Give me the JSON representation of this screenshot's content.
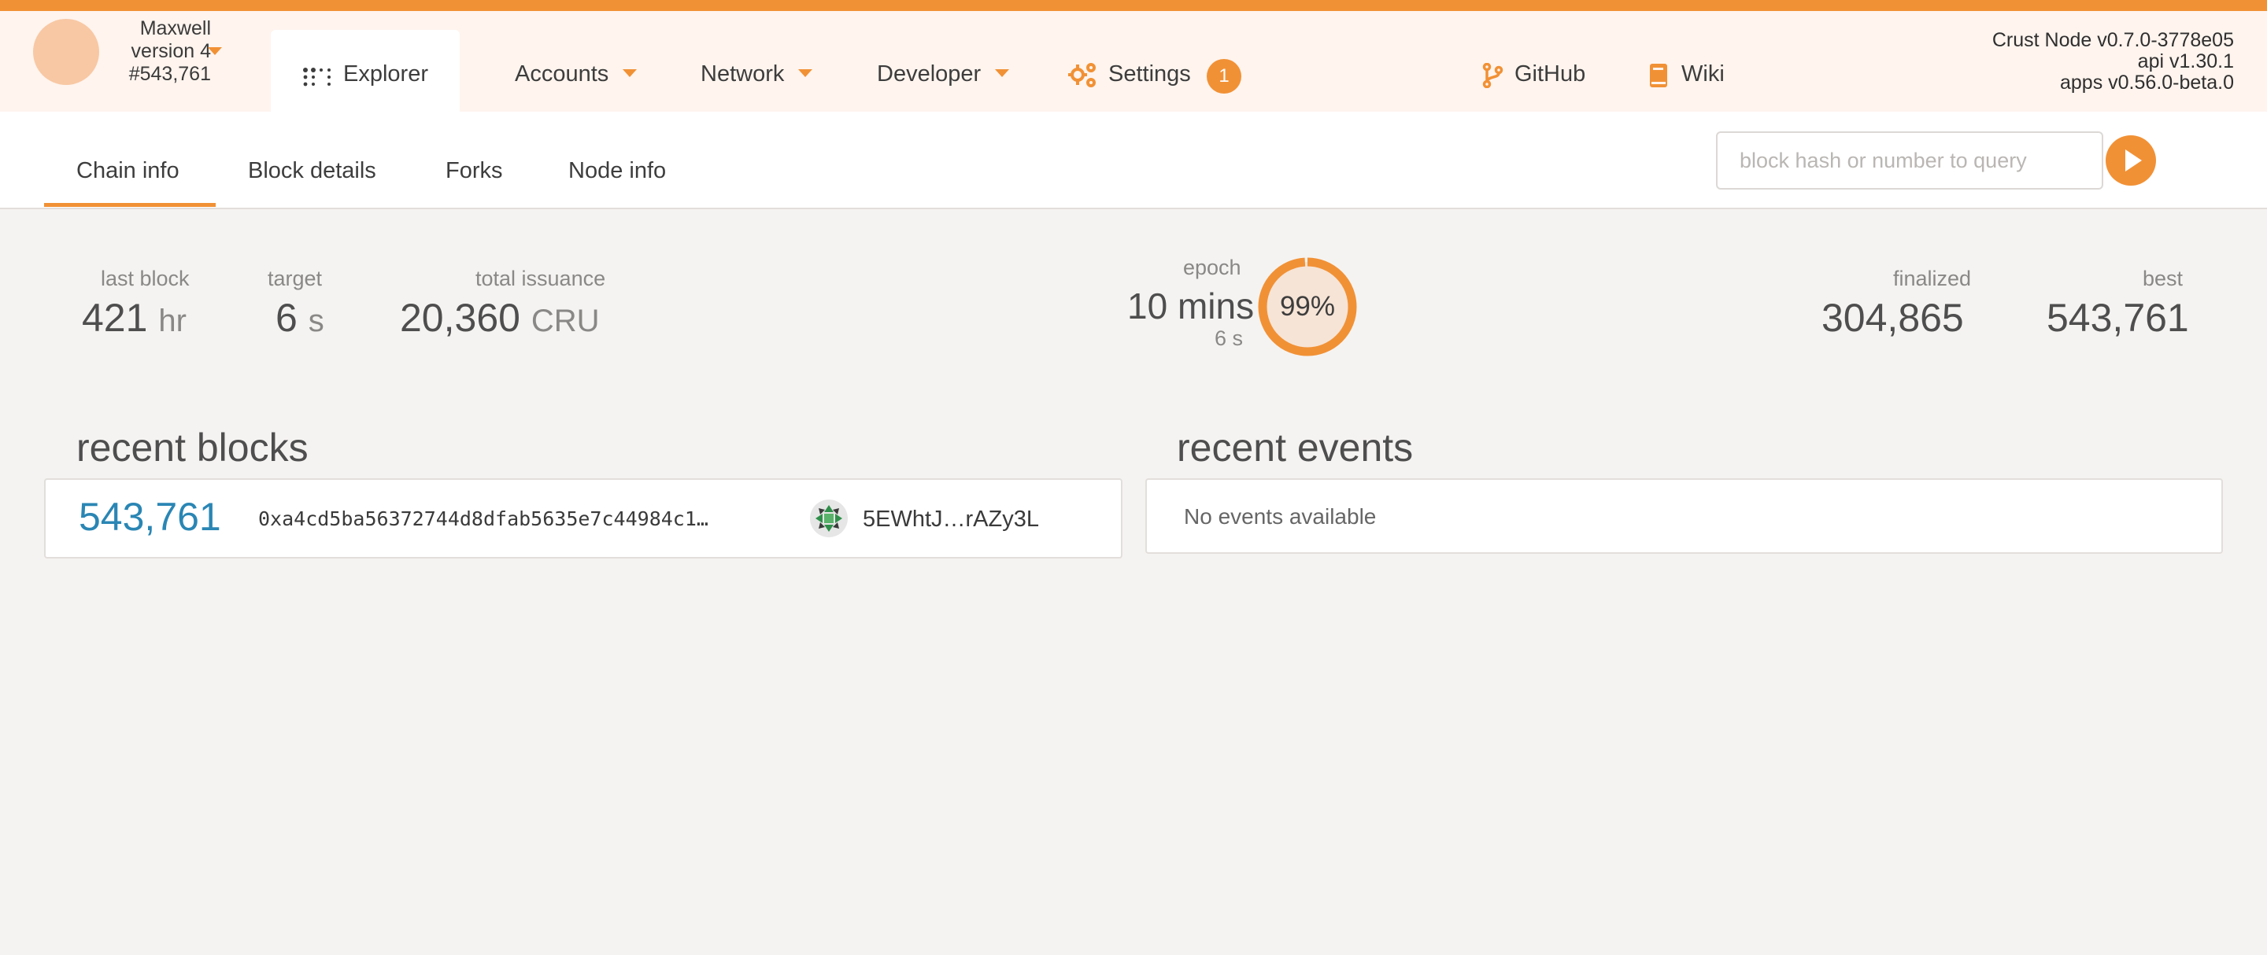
{
  "colors": {
    "accent": "#f19135",
    "block_link": "#2a86b4"
  },
  "chain": {
    "name": "Maxwell",
    "version": "version 4",
    "best_block": "#543,761"
  },
  "nav": {
    "explorer": "Explorer",
    "accounts": "Accounts",
    "network": "Network",
    "developer": "Developer",
    "settings": "Settings",
    "settings_badge": "1",
    "github": "GitHub",
    "wiki": "Wiki"
  },
  "versions": {
    "node": "Crust Node v0.7.0-3778e05",
    "api": "api v1.30.1",
    "apps": "apps v0.56.0-beta.0"
  },
  "tabs": {
    "chain_info": "Chain info",
    "block_details": "Block details",
    "forks": "Forks",
    "node_info": "Node info"
  },
  "query": {
    "placeholder": "block hash or number to query"
  },
  "summary": {
    "last_block": {
      "label": "last block",
      "value": "421",
      "unit": "hr"
    },
    "target": {
      "label": "target",
      "value": "6",
      "unit": "s"
    },
    "total_issuance": {
      "label": "total issuance",
      "value": "20,360",
      "unit": "CRU"
    },
    "epoch": {
      "label": "epoch",
      "value": "10 mins",
      "sub": "6 s",
      "percent": "99%",
      "progress": 0.99
    },
    "finalized": {
      "label": "finalized",
      "value": "304,865"
    },
    "best": {
      "label": "best",
      "value": "543,761"
    }
  },
  "recent_blocks": {
    "title": "recent blocks",
    "rows": [
      {
        "number": "543,761",
        "hash": "0xa4cd5ba56372744d8dfab5635e7c44984c1…",
        "author": "5EWhtJ…rAZy3L"
      }
    ]
  },
  "recent_events": {
    "title": "recent events",
    "empty": "No events available"
  }
}
